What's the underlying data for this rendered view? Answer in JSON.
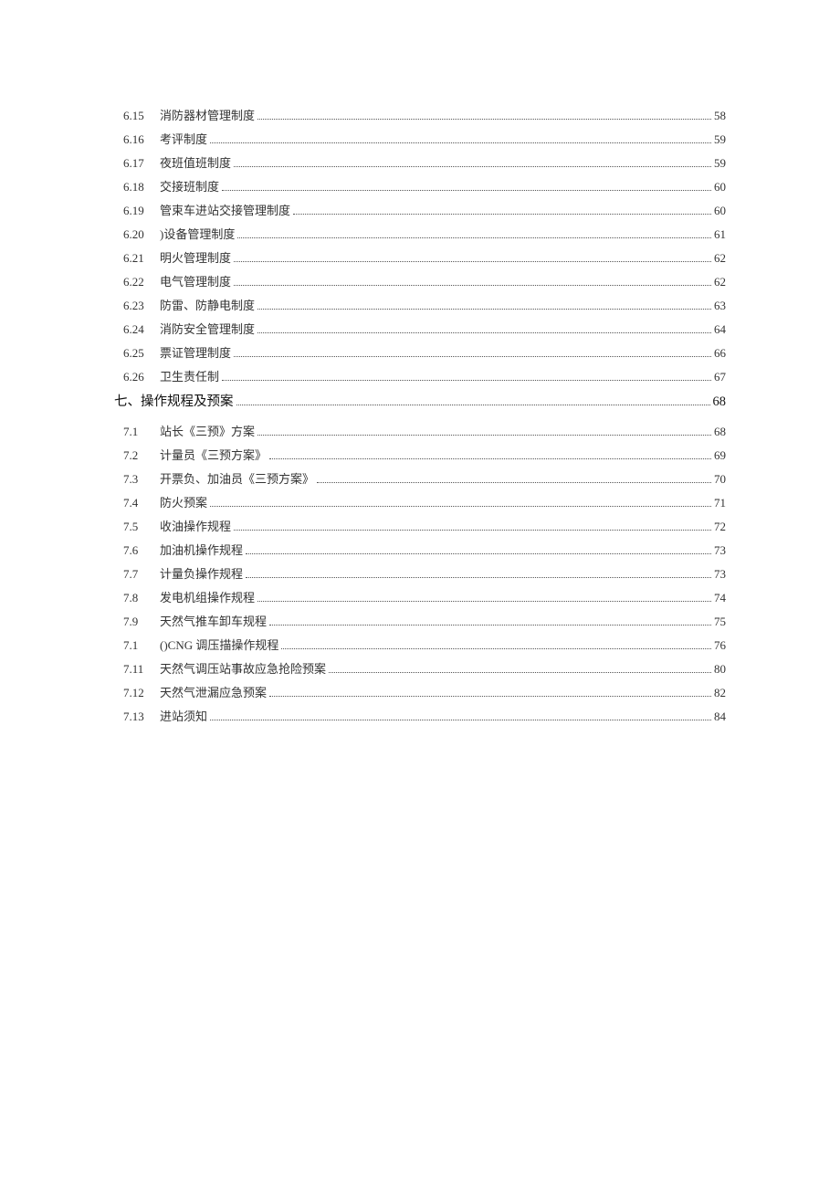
{
  "toc": [
    {
      "level": 2,
      "num": "6.15",
      "title": "消防器材管理制度",
      "page": "58"
    },
    {
      "level": 2,
      "num": "6.16",
      "title": "考评制度",
      "page": "59"
    },
    {
      "level": 2,
      "num": "6.17",
      "title": "夜班值班制度",
      "page": "59"
    },
    {
      "level": 2,
      "num": "6.18",
      "title": "交接班制度",
      "page": "60"
    },
    {
      "level": 2,
      "num": "6.19",
      "title": "管束车进站交接管理制度",
      "page": "60"
    },
    {
      "level": 2,
      "num": "6.20",
      "title": ")设备管理制度",
      "page": "61"
    },
    {
      "level": 2,
      "num": "6.21",
      "title": "明火管理制度",
      "page": "62"
    },
    {
      "level": 2,
      "num": "6.22",
      "title": "电气管理制度",
      "page": "62"
    },
    {
      "level": 2,
      "num": "6.23",
      "title": "防雷、防静电制度",
      "page": "63"
    },
    {
      "level": 2,
      "num": "6.24",
      "title": "消防安全管理制度",
      "page": "64"
    },
    {
      "level": 2,
      "num": "6.25",
      "title": "票证管理制度",
      "page": "66"
    },
    {
      "level": 2,
      "num": "6.26",
      "title": "卫生责任制",
      "page": "67"
    },
    {
      "level": 1,
      "num": "",
      "title": "七、操作规程及预案",
      "page": "68"
    },
    {
      "level": 2,
      "num": "7.1",
      "title": "站长《三预》方案",
      "page": "68"
    },
    {
      "level": 2,
      "num": "7.2",
      "title": "计量员《三预方案》",
      "page": "69"
    },
    {
      "level": 2,
      "num": "7.3",
      "title": "开票负、加油员《三预方案》",
      "page": "70"
    },
    {
      "level": 2,
      "num": "7.4",
      "title": "防火预案",
      "page": "71"
    },
    {
      "level": 2,
      "num": "7.5",
      "title": "收油操作规程",
      "page": "72"
    },
    {
      "level": 2,
      "num": "7.6",
      "title": "加油机操作规程",
      "page": "73"
    },
    {
      "level": 2,
      "num": "7.7",
      "title": "计量负操作规程",
      "page": "73"
    },
    {
      "level": 2,
      "num": "7.8",
      "title": "发电机组操作规程",
      "page": "74"
    },
    {
      "level": 2,
      "num": "7.9",
      "title": "天然气推车卸车规程",
      "page": "75"
    },
    {
      "level": 2,
      "num": "7.1",
      "title": "()CNG 调压描操作规程",
      "page": "76"
    },
    {
      "level": 2,
      "num": "7.11",
      "title": "天然气调压站事故应急抢险预案",
      "page": "80"
    },
    {
      "level": 2,
      "num": "7.12",
      "title": "天然气泄漏应急预案",
      "page": "82"
    },
    {
      "level": 2,
      "num": "7.13",
      "title": "进站须知",
      "page": "84"
    }
  ]
}
